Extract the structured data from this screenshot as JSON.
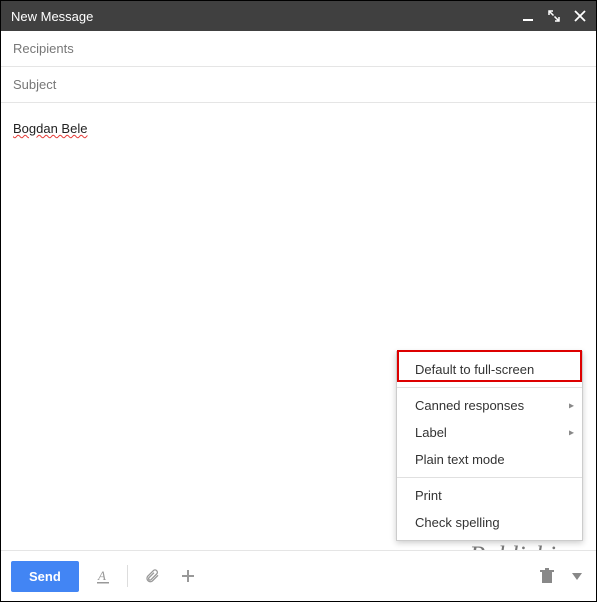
{
  "titlebar": {
    "title": "New Message"
  },
  "fields": {
    "recipients_placeholder": "Recipients",
    "subject_placeholder": "Subject"
  },
  "body": {
    "content": "Bogdan Bele"
  },
  "menu": {
    "default_fullscreen": "Default to full-screen",
    "canned_responses": "Canned responses",
    "label": "Label",
    "plain_text": "Plain text mode",
    "print": "Print",
    "check_spelling": "Check spelling"
  },
  "toolbar": {
    "send_label": "Send"
  },
  "watermark": {
    "text": "groovyPublishing"
  }
}
